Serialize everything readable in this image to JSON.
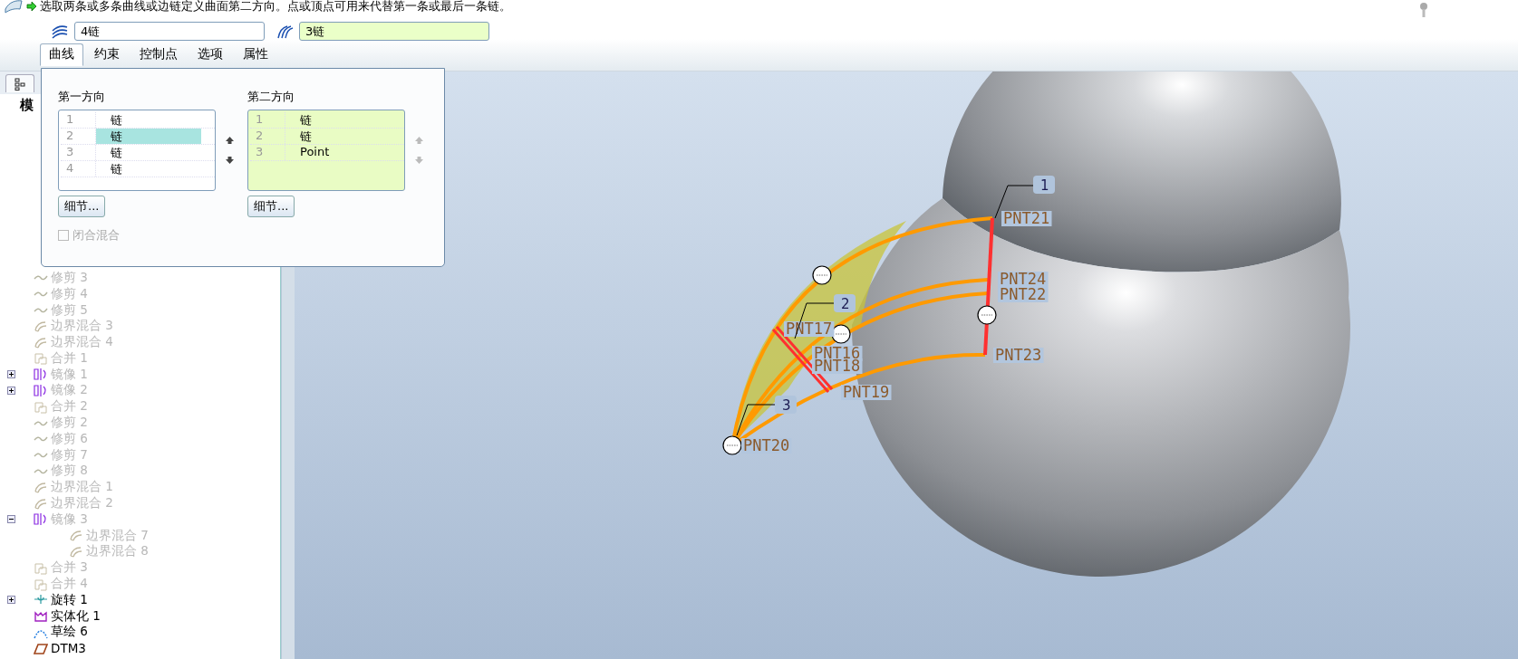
{
  "prompt": {
    "text": "选取两条或多条曲线或边链定义曲面第二方向。点或顶点可用来代替第一条或最后一条链。"
  },
  "collectors": [
    {
      "kind": "first",
      "value": "4链",
      "active": false
    },
    {
      "kind": "second",
      "value": "3链",
      "active": true
    }
  ],
  "tabs": [
    {
      "label": "曲线",
      "selected": true
    },
    {
      "label": "约束",
      "selected": false
    },
    {
      "label": "控制点",
      "selected": false
    },
    {
      "label": "选项",
      "selected": false
    },
    {
      "label": "属性",
      "selected": false
    }
  ],
  "panel": {
    "first_direction": {
      "title": "第一方向",
      "active": false,
      "rows": [
        {
          "index": "1",
          "value": "链",
          "selected": false
        },
        {
          "index": "2",
          "value": "链",
          "selected": true
        },
        {
          "index": "3",
          "value": "链",
          "selected": false
        },
        {
          "index": "4",
          "value": "链",
          "selected": false
        }
      ],
      "details": "细节...",
      "arrows_enabled": true
    },
    "second_direction": {
      "title": "第二方向",
      "active": true,
      "rows": [
        {
          "index": "1",
          "value": "链",
          "selected": false
        },
        {
          "index": "2",
          "value": "链",
          "selected": false
        },
        {
          "index": "3",
          "value": "Point",
          "selected": false
        }
      ],
      "details": "细节...",
      "arrows_enabled": false
    },
    "closed_blend": {
      "label": "闭合混合",
      "checked": false,
      "disabled": true
    }
  },
  "model_tree": {
    "header": "模",
    "items": [
      {
        "kind": "trim",
        "label": "修剪 3",
        "disabled": true
      },
      {
        "kind": "trim",
        "label": "修剪 4",
        "disabled": true
      },
      {
        "kind": "trim",
        "label": "修剪 5",
        "disabled": true
      },
      {
        "kind": "blend",
        "label": "边界混合 3",
        "disabled": true
      },
      {
        "kind": "blend",
        "label": "边界混合 4",
        "disabled": true
      },
      {
        "kind": "merge",
        "label": "合并 1",
        "disabled": true
      },
      {
        "kind": "mirror",
        "label": "镜像 1",
        "disabled": true,
        "expanded": false
      },
      {
        "kind": "mirror",
        "label": "镜像 2",
        "disabled": true,
        "expanded": false
      },
      {
        "kind": "merge",
        "label": "合并 2",
        "disabled": true
      },
      {
        "kind": "trim",
        "label": "修剪 2",
        "disabled": true
      },
      {
        "kind": "trim",
        "label": "修剪 6",
        "disabled": true
      },
      {
        "kind": "trim",
        "label": "修剪 7",
        "disabled": true
      },
      {
        "kind": "trim",
        "label": "修剪 8",
        "disabled": true
      },
      {
        "kind": "blend",
        "label": "边界混合 1",
        "disabled": true
      },
      {
        "kind": "blend",
        "label": "边界混合 2",
        "disabled": true
      },
      {
        "kind": "mirror",
        "label": "镜像 3",
        "disabled": true,
        "expanded": true,
        "children": [
          {
            "kind": "blend",
            "label": "边界混合 7",
            "disabled": true
          },
          {
            "kind": "blend",
            "label": "边界混合 8",
            "disabled": true
          }
        ]
      },
      {
        "kind": "merge",
        "label": "合并 3",
        "disabled": true
      },
      {
        "kind": "merge",
        "label": "合并 4",
        "disabled": true
      },
      {
        "kind": "revolve",
        "label": "旋转 1",
        "disabled": false,
        "expanded": false
      },
      {
        "kind": "solidify",
        "label": "实体化 1",
        "disabled": false
      },
      {
        "kind": "sketch",
        "label": "草绘 6",
        "disabled": false
      },
      {
        "kind": "datum",
        "label": "DTM3",
        "disabled": false
      }
    ]
  },
  "viewport": {
    "point_labels": [
      {
        "text": "PNT21"
      },
      {
        "text": "PNT24"
      },
      {
        "text": "PNT22"
      },
      {
        "text": "PNT23"
      },
      {
        "text": "PNT17"
      },
      {
        "text": "PNT16"
      },
      {
        "text": "PNT18"
      },
      {
        "text": "PNT19"
      },
      {
        "text": "PNT20"
      }
    ],
    "callouts": [
      {
        "text": "1"
      },
      {
        "text": "2"
      },
      {
        "text": "3"
      }
    ]
  }
}
